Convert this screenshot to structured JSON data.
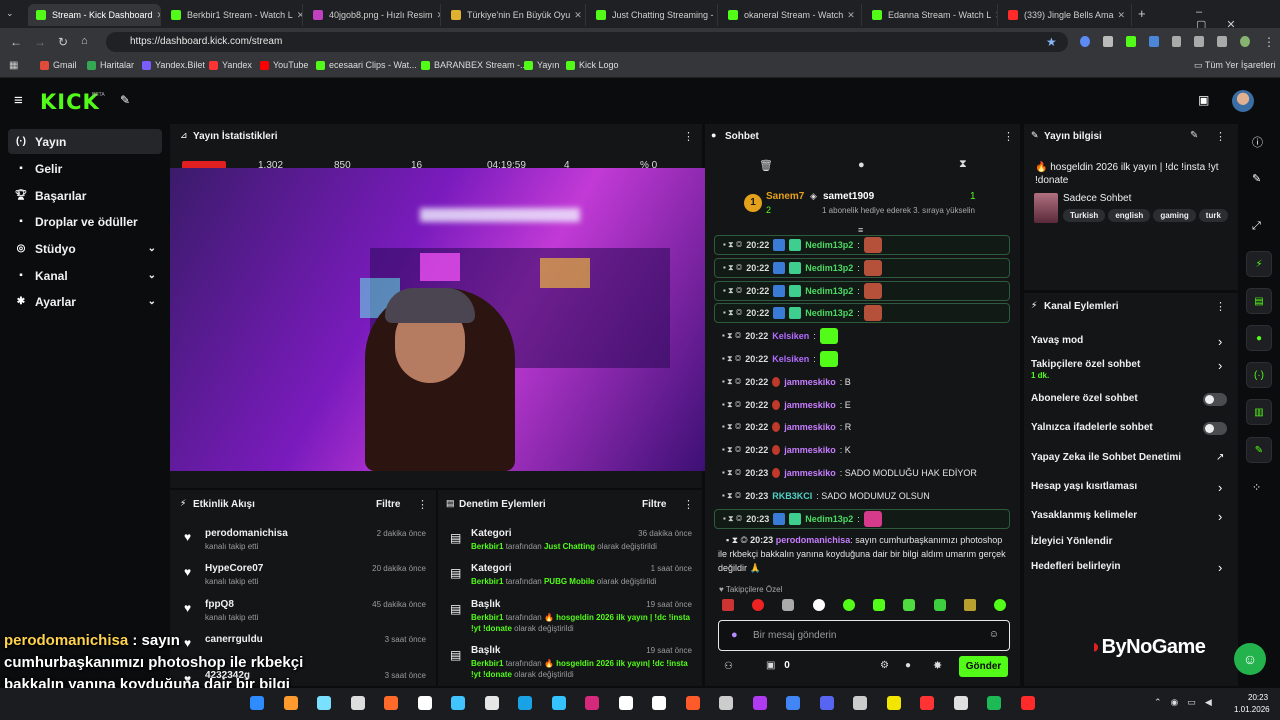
{
  "browser": {
    "tabs": [
      {
        "label": "Stream - Kick Dashboard",
        "color": "#53fc18",
        "active": true
      },
      {
        "label": "Berkbir1 Stream - Watch L",
        "color": "#53fc18"
      },
      {
        "label": "40jgob8.png - Hızlı Resim",
        "color": "#c040c0"
      },
      {
        "label": "Türkiye'nin En Büyük Oyu",
        "color": "#e0b030"
      },
      {
        "label": "Just Chatting Streaming -",
        "color": "#53fc18"
      },
      {
        "label": "okaneral Stream - Watch",
        "color": "#53fc18"
      },
      {
        "label": "Edanna Stream - Watch L",
        "color": "#53fc18"
      },
      {
        "label": "(339) Jingle Bells Ama",
        "color": "#ff2a2a"
      }
    ],
    "url": "https://dashboard.kick.com/stream",
    "bookmarks": [
      {
        "label": "Gmail",
        "color": "#e24b3b"
      },
      {
        "label": "Haritalar",
        "color": "#34a853"
      },
      {
        "label": "Yandex.Bilet",
        "color": "#7a5cff"
      },
      {
        "label": "Yandex",
        "color": "#ff3333"
      },
      {
        "label": "YouTube",
        "color": "#ff0000"
      },
      {
        "label": "ecesaari Clips - Wat...",
        "color": "#53fc18"
      },
      {
        "label": "BARANBEX Stream -...",
        "color": "#53fc18"
      },
      {
        "label": "Yayın",
        "color": "#53fc18"
      },
      {
        "label": "Kick Logo",
        "color": "#53fc18"
      }
    ],
    "bookmarks_right": "Tüm Yer İşaretleri"
  },
  "header": {
    "logo": "KICK",
    "beta": "BETA"
  },
  "sidebar": {
    "items": [
      {
        "label": "Yayın",
        "icon": "(·)",
        "active": true
      },
      {
        "label": "Gelir",
        "icon": "▪"
      },
      {
        "label": "Başarılar",
        "icon": "🏆︎"
      },
      {
        "label": "Droplar ve ödüller",
        "icon": "▪"
      },
      {
        "label": "Stüdyo",
        "icon": "◎",
        "chev": true
      },
      {
        "label": "Kanal",
        "icon": "▪",
        "chev": true
      },
      {
        "label": "Ayarlar",
        "icon": "✱",
        "chev": true
      }
    ]
  },
  "stats": {
    "title": "Yayın İstatistikleri",
    "values": [
      "1.302",
      "850",
      "16",
      "04:19:59",
      "4",
      "% 0"
    ]
  },
  "chat": {
    "title": "Sohbet",
    "top1": {
      "rank": "1",
      "name": "Sanem7",
      "count": "2"
    },
    "top2": {
      "name": "samet1909",
      "count": "1",
      "note": "1 abonelik hediye ederek 3. sıraya yükselin"
    },
    "messages": [
      {
        "time": "20:22",
        "user": "Nedim13p2",
        "color": "#4cd964",
        "text": ":",
        "hl": true,
        "emote": "#b5503a"
      },
      {
        "time": "20:22",
        "user": "Nedim13p2",
        "color": "#4cd964",
        "text": ":",
        "hl": true,
        "emote": "#b5503a"
      },
      {
        "time": "20:22",
        "user": "Nedim13p2",
        "color": "#4cd964",
        "text": ":",
        "hl": true,
        "emote": "#b5503a"
      },
      {
        "time": "20:22",
        "user": "Nedim13p2",
        "color": "#4cd964",
        "text": ":",
        "hl": true,
        "emote": "#b5503a"
      },
      {
        "time": "20:22",
        "user": "Kelsiken",
        "color": "#b36cff",
        "text": ":",
        "emote": "#53fc18"
      },
      {
        "time": "20:22",
        "user": "Kelsiken",
        "color": "#b36cff",
        "text": ":",
        "emote": "#53fc18"
      },
      {
        "time": "20:22",
        "user": "jammeskiko",
        "color": "#c77dff",
        "text": ": B"
      },
      {
        "time": "20:22",
        "user": "jammeskiko",
        "color": "#c77dff",
        "text": ": E"
      },
      {
        "time": "20:22",
        "user": "jammeskiko",
        "color": "#c77dff",
        "text": ": R"
      },
      {
        "time": "20:22",
        "user": "jammeskiko",
        "color": "#c77dff",
        "text": ": K"
      },
      {
        "time": "20:23",
        "user": "jammeskiko",
        "color": "#c77dff",
        "text": ": SADO MODLUĞU HAK EDİYOR"
      },
      {
        "time": "20:23",
        "user": "RKB3KCI",
        "color": "#4fd1c5",
        "text": ": SADO MODUMUZ OLSUN"
      },
      {
        "time": "20:23",
        "user": "Nedim13p2",
        "color": "#4cd964",
        "text": ":",
        "hl": true,
        "emote": "#d63a8a"
      }
    ],
    "long_user": "perodomanichisa",
    "long_time": "20:23",
    "long_text": ": sayın cumhurbaşkanımızı photoshop ile rkbekçi bakkalın yanına koyduğuna dair bir bilgi aldım umarım gerçek değildir 🙏",
    "followers_only": "Takipçilere Özel",
    "input_placeholder": "Bir mesaj gönderin",
    "send": "Gönder",
    "points": "0"
  },
  "events": {
    "title": "Etkinlik Akışı",
    "filter": "Filtre",
    "items": [
      {
        "name": "perodomanichisa",
        "sub": "kanalı takip etti",
        "time": "2 dakika önce"
      },
      {
        "name": "HypeCore07",
        "sub": "kanalı takip etti",
        "time": "20 dakika önce"
      },
      {
        "name": "fppQ8",
        "sub": "kanalı takip etti",
        "time": "45 dakika önce"
      },
      {
        "name": "canerrguldu",
        "sub": "",
        "time": "3 saat önce"
      },
      {
        "name": "4232342g",
        "sub": "",
        "time": "3 saat önce"
      }
    ]
  },
  "moderation": {
    "title": "Denetim Eylemleri",
    "filter": "Filtre",
    "items": [
      {
        "type": "Kategori",
        "user": "Berkbir1",
        "mid": " tarafından ",
        "value": "Just Chatting",
        "tail": " olarak değiştirildi",
        "time": "36 dakika önce"
      },
      {
        "type": "Kategori",
        "user": "Berkbir1",
        "mid": " tarafından ",
        "value": "PUBG Mobile",
        "tail": " olarak değiştirildi",
        "time": "1 saat önce"
      },
      {
        "type": "Başlık",
        "user": "Berkbir1",
        "mid": " tarafından ",
        "value": "🔥 hosgeldin 2026 ilk yayın | !dc !insta !yt !donate",
        "tail": " olarak değiştirildi",
        "time": "19 saat önce"
      },
      {
        "type": "Başlık",
        "user": "Berkbir1",
        "mid": " tarafından ",
        "value": "🔥 hosgeldin 2026 ilk yayın| !dc !insta !yt !donate",
        "tail": " olarak değiştirildi",
        "time": "19 saat önce"
      }
    ]
  },
  "info": {
    "title": "Yayın bilgisi",
    "stream_title": "🔥 hosgeldin 2026 ilk yayın | !dc !insta !yt !donate",
    "category": "Sadece Sohbet",
    "tags": [
      "Turkish",
      "english",
      "gaming",
      "turk"
    ]
  },
  "channel_actions": {
    "title": "Kanal Eylemleri",
    "items": [
      {
        "label": "Yavaş mod",
        "ctrl": "chev"
      },
      {
        "label": "Takipçilere özel sohbet",
        "sub": "1 dk.",
        "ctrl": "chev"
      },
      {
        "label": "Abonelere özel sohbet",
        "ctrl": "toggle"
      },
      {
        "label": "Yalnızca ifadelerle sohbet",
        "ctrl": "toggle"
      },
      {
        "label": "Yapay Zeka ile Sohbet Denetimi",
        "ctrl": "ext"
      },
      {
        "label": "Hesap yaşı kısıtlaması",
        "ctrl": "chev"
      },
      {
        "label": "Yasaklanmış kelimeler",
        "ctrl": "chev"
      },
      {
        "label": "İzleyici Yönlendir",
        "ctrl": ""
      },
      {
        "label": "Hedefleri belirleyin",
        "ctrl": "chev"
      }
    ]
  },
  "overlay": {
    "user": "perodomanichisa",
    "text": " : sayın cumhurbaşkanımızı photoshop ile rkbekçi bakkalın yanına koyduğuna dair bir bilgi aldım umarım gerçek değildir"
  },
  "watermark": "ByNoGame",
  "clock": {
    "time": "20:23",
    "date": "1.01.2026"
  }
}
